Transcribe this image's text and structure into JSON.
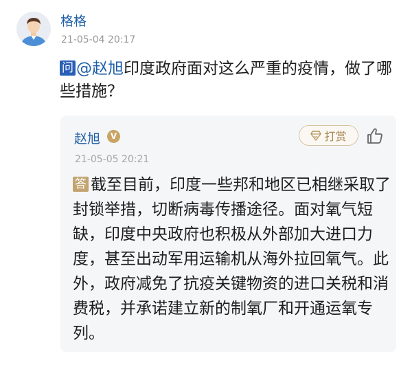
{
  "question": {
    "asker_name": "格格",
    "timestamp": "21-05-04 20:17",
    "tag": "问",
    "mention": "@赵旭",
    "text": "印度政府面对这么严重的疫情，做了哪些措施？"
  },
  "answer": {
    "author_name": "赵旭",
    "verified_badge": "V",
    "reward_label": "打赏",
    "timestamp": "21-05-05 20:21",
    "tag": "答",
    "text": "截至目前，印度一些邦和地区已相继采取了封锁举措，切断病毒传播途径。面对氧气短缺，印度中央政府也积极从外部加大进口力度，甚至出动军用运输机从海外拉回氧气。此外，政府减免了抗疫关键物资的进口关税和消费税，并承诺建立新的制氧厂和开通运氧专列。"
  },
  "icons": {
    "avatar": "user-avatar",
    "reward": "gem-icon",
    "like": "thumbs-up-icon"
  },
  "colors": {
    "link_blue": "#1f5fa8",
    "question_tag": "#2a5fb8",
    "answer_tag": "#c3a470",
    "card_bg": "#f5f6f8"
  }
}
